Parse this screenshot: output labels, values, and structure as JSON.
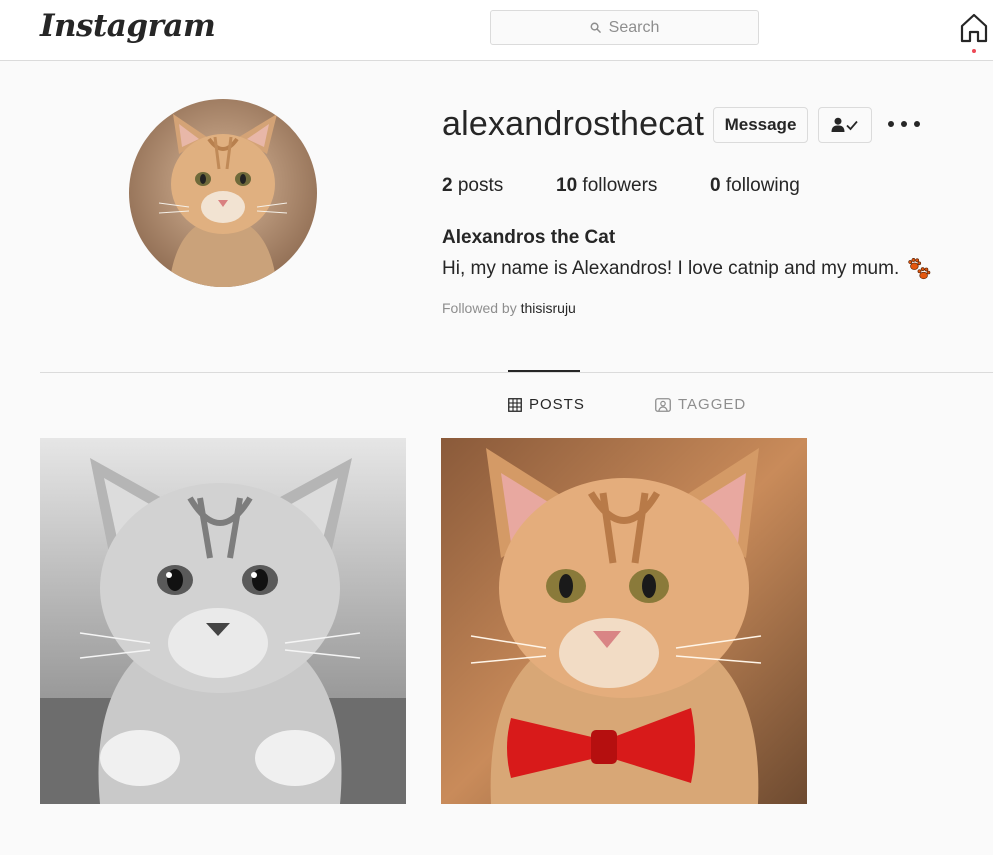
{
  "header": {
    "logo_text": "Instagram",
    "search_placeholder": "Search"
  },
  "profile": {
    "username": "alexandrosthecat",
    "message_label": "Message",
    "stats": {
      "posts_count": "2",
      "posts_label": "posts",
      "followers_count": "10",
      "followers_label": "followers",
      "following_count": "0",
      "following_label": "following"
    },
    "full_name": "Alexandros the Cat",
    "bio": "Hi, my name is Alexandros! I love catnip and my mum.",
    "followed_by_prefix": "Followed by",
    "followed_by_user": "thisisruju"
  },
  "tabs": {
    "posts_label": "POSTS",
    "tagged_label": "TAGGED"
  },
  "colors": {
    "notification_dot": "#ed4956",
    "bow_tie": "#d81a1a",
    "text_primary": "#262626",
    "text_secondary": "#8e8e8e"
  }
}
